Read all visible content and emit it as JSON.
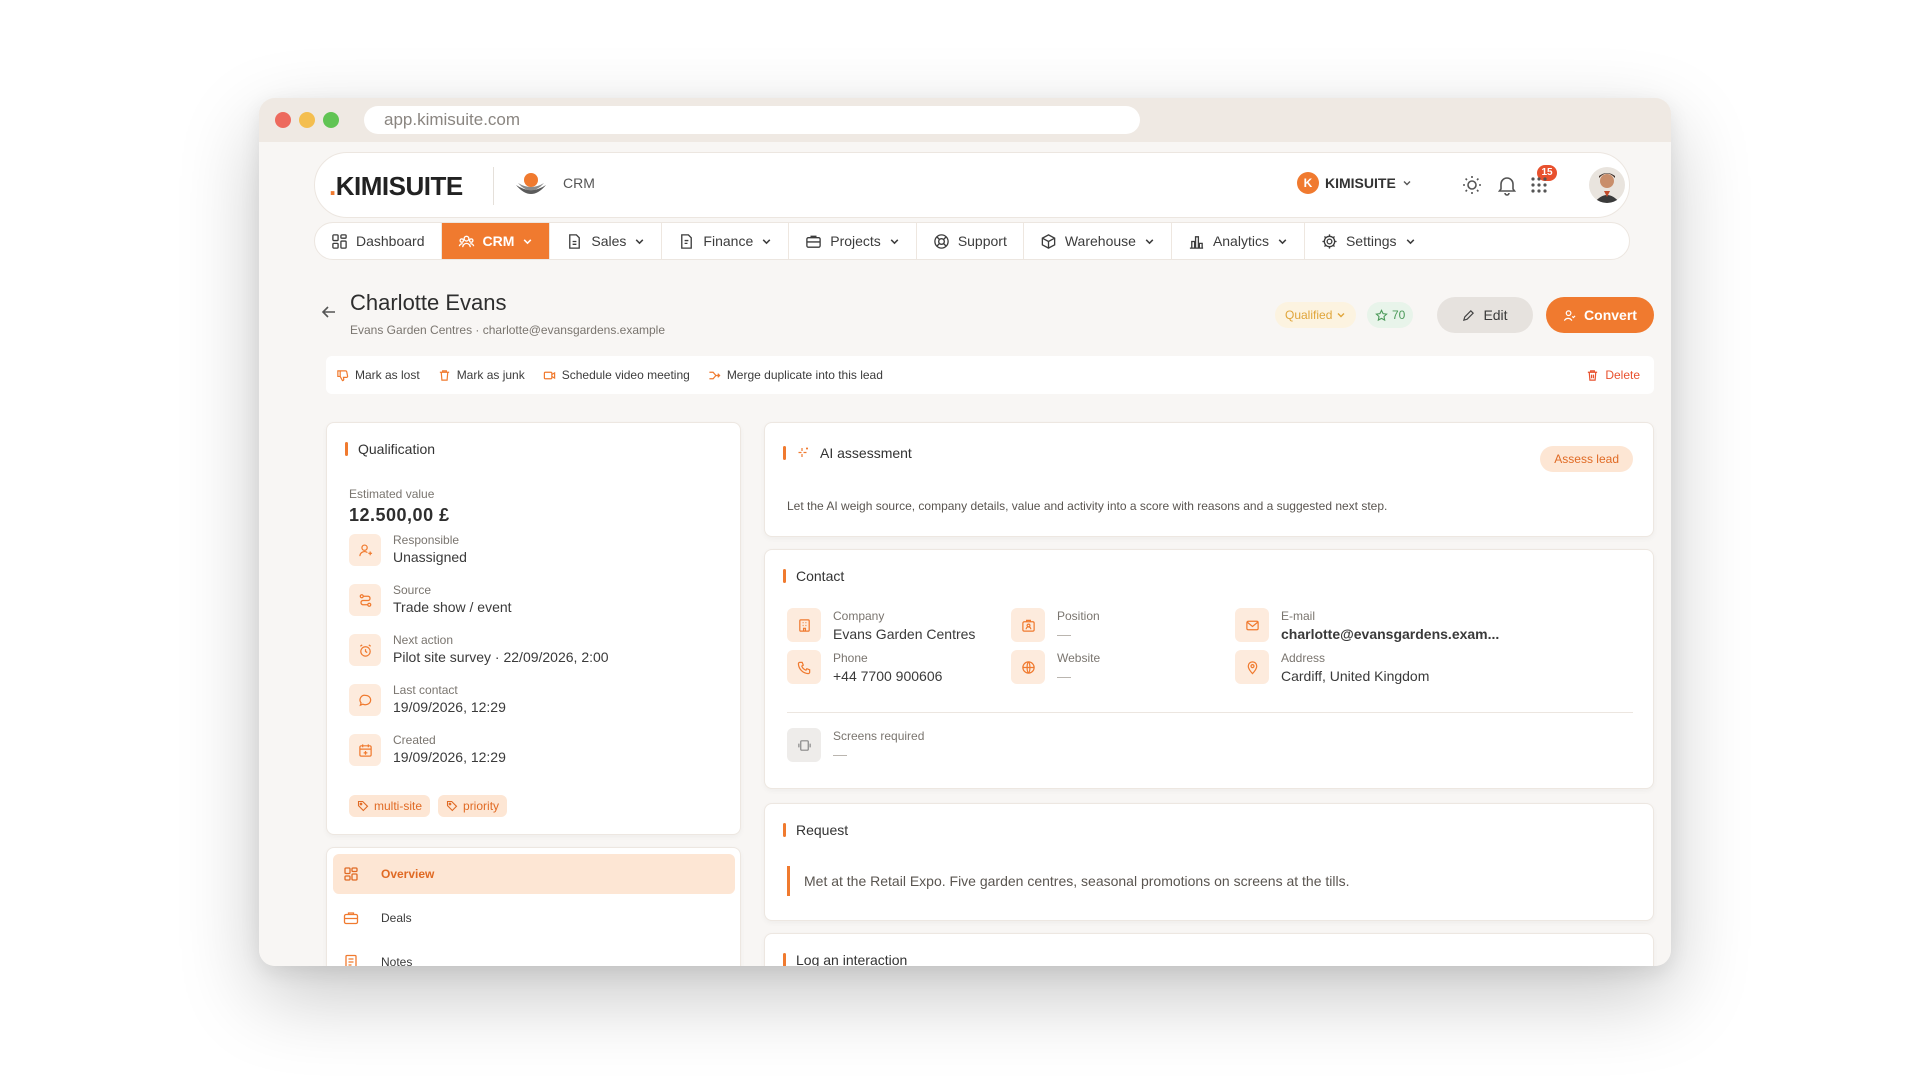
{
  "browser": {
    "url": "app.kimisuite.com"
  },
  "header": {
    "logo_text": "KIMISUITE",
    "module": "CRM",
    "tenant_initial": "K",
    "tenant_name": "KIMISUITE",
    "notifications_count": "15"
  },
  "nav": {
    "items": [
      {
        "label": "Dashboard",
        "icon": "dashboard-icon"
      },
      {
        "label": "CRM",
        "icon": "users-icon",
        "active": true
      },
      {
        "label": "Sales",
        "icon": "document-icon"
      },
      {
        "label": "Finance",
        "icon": "invoice-icon"
      },
      {
        "label": "Projects",
        "icon": "briefcase-icon"
      },
      {
        "label": "Support",
        "icon": "lifebuoy-icon"
      },
      {
        "label": "Warehouse",
        "icon": "box-icon"
      },
      {
        "label": "Analytics",
        "icon": "bar-chart-icon"
      },
      {
        "label": "Settings",
        "icon": "gear-icon"
      }
    ]
  },
  "lead": {
    "name": "Charlotte Evans",
    "subtitle": "Evans Garden Centres · charlotte@evansgardens.example",
    "status": "Qualified",
    "score": "70",
    "edit_label": "Edit",
    "convert_label": "Convert"
  },
  "actions": {
    "mark_lost": "Mark as lost",
    "mark_junk": "Mark as junk",
    "schedule_video": "Schedule video meeting",
    "merge_duplicate": "Merge duplicate into this lead",
    "delete": "Delete"
  },
  "qualification": {
    "title": "Qualification",
    "estimated_label": "Estimated value",
    "estimated_value": "12.500,00 £",
    "rows": [
      {
        "label": "Responsible",
        "value": "Unassigned",
        "icon": "user-icon"
      },
      {
        "label": "Source",
        "value": "Trade show / event",
        "icon": "route-icon"
      },
      {
        "label": "Next action",
        "value": "Pilot site survey · 22/09/2026, 2:00",
        "icon": "alarm-icon"
      },
      {
        "label": "Last contact",
        "value": "19/09/2026, 12:29",
        "icon": "chat-icon"
      },
      {
        "label": "Created",
        "value": "19/09/2026, 12:29",
        "icon": "calendar-plus-icon"
      }
    ],
    "tags": [
      "multi-site",
      "priority"
    ]
  },
  "sidenav": {
    "items": [
      {
        "label": "Overview",
        "icon": "grid-icon",
        "active": true
      },
      {
        "label": "Deals",
        "icon": "briefcase-icon"
      },
      {
        "label": "Notes",
        "icon": "notes-icon"
      }
    ]
  },
  "ai": {
    "title": "AI assessment",
    "button": "Assess lead",
    "text": "Let the AI weigh source, company details, value and activity into a score with reasons and a suggested next step."
  },
  "contact": {
    "title": "Contact",
    "company_label": "Company",
    "company": "Evans Garden Centres",
    "position_label": "Position",
    "position": "—",
    "email_label": "E-mail",
    "email": "charlotte@evansgardens.exam...",
    "phone_label": "Phone",
    "phone": "+44 7700 900606",
    "website_label": "Website",
    "website": "—",
    "address_label": "Address",
    "address": "Cardiff, United Kingdom",
    "screens_label": "Screens required",
    "screens": "—"
  },
  "request": {
    "title": "Request",
    "text": "Met at the Retail Expo. Five garden centres, seasonal promotions on screens at the tills."
  },
  "log": {
    "title": "Log an interaction"
  },
  "colors": {
    "accent": "#f07a2f",
    "accent_soft": "#fde6d4",
    "status": "#e0a53a",
    "score": "#4c9a5a",
    "danger": "#e8512e"
  }
}
